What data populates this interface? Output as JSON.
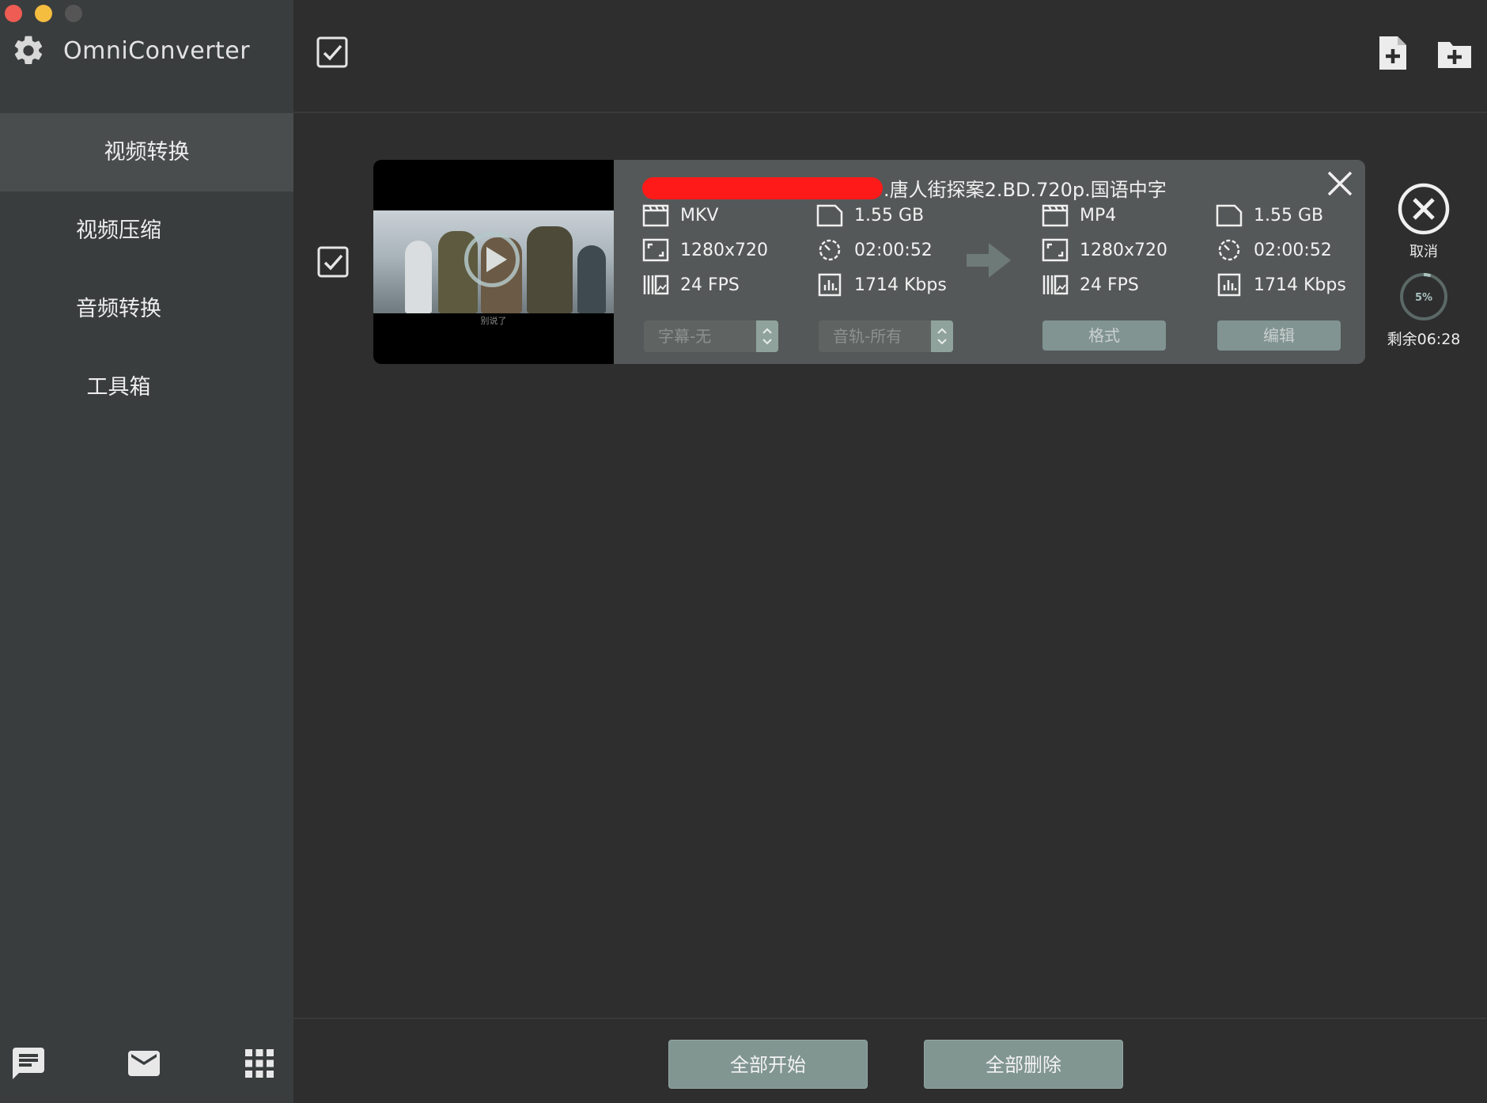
{
  "app": {
    "name": "OmniConverter",
    "icon": "gear-icon"
  },
  "colors": {
    "sidebar_bg": "#3a3d3e",
    "content_bg": "#2e2e2e",
    "card_bg": "#555858",
    "accent_button": "#819591",
    "redaction": "#ff1a1a"
  },
  "sidebar": {
    "items": [
      {
        "label": "视频转换",
        "active": true
      },
      {
        "label": "视频压缩",
        "active": false
      },
      {
        "label": "音频转换",
        "active": false
      },
      {
        "label": "工具箱",
        "active": false
      }
    ],
    "footer_icons": [
      "chat-icon",
      "mail-icon",
      "grid-icon"
    ]
  },
  "toolbar": {
    "select_all_checked": true,
    "actions": [
      "add-file-icon",
      "add-folder-icon"
    ]
  },
  "task": {
    "checked": true,
    "title": ".唐人街探案2.BD.720p.国语中字",
    "thumbnail_caption": "别说了",
    "source": {
      "format": "MKV",
      "size": "1.55 GB",
      "resolution": "1280x720",
      "duration": "02:00:52",
      "fps": "24 FPS",
      "bitrate": "1714 Kbps"
    },
    "target": {
      "format": "MP4",
      "size": "1.55 GB",
      "resolution": "1280x720",
      "duration": "02:00:52",
      "fps": "24 FPS",
      "bitrate": "1714 Kbps"
    },
    "subtitle_select": "字幕-无",
    "audio_select": "音轨-所有",
    "format_button": "格式",
    "edit_button": "编辑",
    "cancel_label": "取消",
    "progress_percent": 5,
    "progress_label": "5%",
    "remaining": "剩余06:28"
  },
  "footer": {
    "start_all": "全部开始",
    "delete_all": "全部删除"
  }
}
